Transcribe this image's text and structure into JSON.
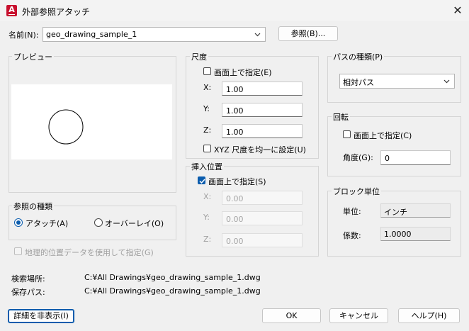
{
  "window": {
    "title": "外部参照アタッチ",
    "app_icon_letter": "A"
  },
  "name_row": {
    "label": "名前(N):",
    "value": "geo_drawing_sample_1",
    "browse_label": "参照(B)..."
  },
  "preview": {
    "title": "プレビュー"
  },
  "scale": {
    "title": "尺度",
    "specify_on_screen": "画面上で指定(E)",
    "x_label": "X:",
    "x_value": "1.00",
    "y_label": "Y:",
    "y_value": "1.00",
    "z_label": "Z:",
    "z_value": "1.00",
    "uniform_label": "XYZ 尺度を均一に設定(U)"
  },
  "insertion": {
    "title": "挿入位置",
    "specify_on_screen": "画面上で指定(S)",
    "x_label": "X:",
    "x_value": "0.00",
    "y_label": "Y:",
    "y_value": "0.00",
    "z_label": "Z:",
    "z_value": "0.00"
  },
  "path_type": {
    "title": "パスの種類(P)",
    "value": "相対パス"
  },
  "rotation": {
    "title": "回転",
    "specify_on_screen": "画面上で指定(C)",
    "angle_label": "角度(G):",
    "angle_value": "0"
  },
  "block_unit": {
    "title": "ブロック単位",
    "unit_label": "単位:",
    "unit_value": "インチ",
    "factor_label": "係数:",
    "factor_value": "1.0000"
  },
  "reference_type": {
    "title": "参照の種類",
    "attach_label": "アタッチ(A)",
    "overlay_label": "オーバーレイ(O)"
  },
  "geo_location": {
    "label": "地理的位置データを使用して指定(G)"
  },
  "paths": {
    "found_label": "検索場所:",
    "found_value": "C:¥All Drawings¥geo_drawing_sample_1.dwg",
    "saved_label": "保存パス:",
    "saved_value": "C:¥All Drawings¥geo_drawing_sample_1.dwg"
  },
  "buttons": {
    "details": "詳細を非表示(I)",
    "ok": "OK",
    "cancel": "キャンセル",
    "help": "ヘルプ(H)"
  },
  "colors": {
    "accent": "#0b5cad",
    "app_icon": "#c8102e"
  }
}
